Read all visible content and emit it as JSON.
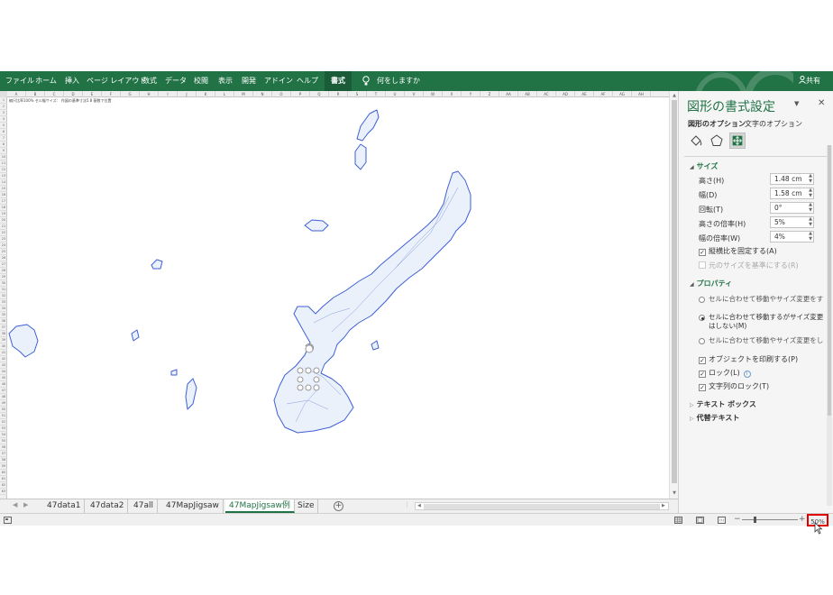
{
  "ribbon": {
    "tabs": [
      "ファイル",
      "ホーム",
      "挿入",
      "ページ レイアウト",
      "数式",
      "データ",
      "校閲",
      "表示",
      "開発",
      "アドイン",
      "ヘルプ",
      "書式"
    ],
    "active_tab": "書式",
    "tell_me": "何をしますか",
    "share": "共有"
  },
  "sheet": {
    "column_headers": [
      "A",
      "B",
      "C",
      "D",
      "E",
      "F",
      "G",
      "H",
      "I",
      "J",
      "K",
      "L",
      "M",
      "N",
      "O",
      "P",
      "Q",
      "R",
      "S",
      "T",
      "U",
      "V",
      "W",
      "X",
      "Y",
      "Z",
      "AA",
      "AB",
      "AC",
      "AD",
      "AE",
      "AF",
      "AG",
      "AH"
    ],
    "cell_note": "縮尺比率100%  セル幅サイズ：  作図の基準寸法5.8  基数で位置"
  },
  "sheet_tabs": [
    "47data1",
    "47data2",
    "47all",
    "47MapJigsaw",
    "47MapJigsaw例",
    "Size"
  ],
  "active_sheet": "47MapJigsaw例",
  "status": {
    "zoom": "50%"
  },
  "pane": {
    "title": "図形の書式設定",
    "option_tabs": [
      "図形のオプション",
      "文字のオプション"
    ],
    "size_section": "サイズ",
    "fields": [
      {
        "label": "高さ(H)",
        "value": "1.48 cm"
      },
      {
        "label": "幅(D)",
        "value": "1.58 cm"
      },
      {
        "label": "回転(T)",
        "value": "0°"
      },
      {
        "label": "高さの倍率(H)",
        "value": "5%"
      },
      {
        "label": "幅の倍率(W)",
        "value": "4%"
      }
    ],
    "lock_aspect": "縦横比を固定する(A)",
    "relative_original": "元のサイズを基準にする(R)",
    "properties_section": "プロパティ",
    "radios": [
      "セルに合わせて移動やサイズ変更をする(S)",
      "セルに合わせて移動するがサイズ変更はしない(M)",
      "セルに合わせて移動やサイズ変更をしない(D)"
    ],
    "print_object": "オブジェクトを印刷する(P)",
    "locked": "ロック(L)",
    "lock_text": "文字列のロック(T)",
    "textbox_section": "テキスト ボックス",
    "alt_text_section": "代替テキスト"
  },
  "colors": {
    "excel_green": "#217346",
    "map_fill": "#eaf1fb",
    "map_stroke": "#3f5fd6",
    "zoom_highlight": "#e00000"
  }
}
